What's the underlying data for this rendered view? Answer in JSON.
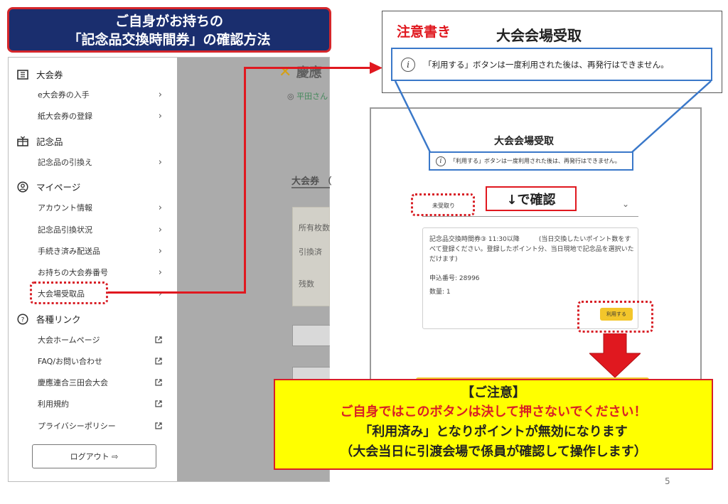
{
  "title": {
    "line1": "ご自身がお持ちの",
    "line2": "「記念品交換時間券」の確認方法"
  },
  "menu": {
    "section_tickets": "大会券",
    "item_e_ticket": "e大会券の入手",
    "item_paper_ticket": "紙大会券の登録",
    "section_souvenir": "記念品",
    "item_souvenir_exchange": "記念品の引換え",
    "section_mypage": "マイページ",
    "item_account": "アカウント情報",
    "item_souvenir_status": "記念品引換状況",
    "item_shipped": "手続き済み配送品",
    "item_ticket_numbers": "お持ちの大会券番号",
    "item_venue_pickup": "大会場受取品",
    "section_links": "各種リンク",
    "link_homepage": "大会ホームページ",
    "link_faq": "FAQ/お問い合わせ",
    "link_keio": "慶應連合三田会大会",
    "link_terms": "利用規約",
    "link_privacy": "プライバシーポリシー",
    "logout": "ログアウト ⇨"
  },
  "app_behind": {
    "logo": "慶應",
    "user": "平田さん",
    "tab": "大会券 （",
    "owned": "所有枚数",
    "redeemed": "引換済",
    "remaining": "残数"
  },
  "note": {
    "label": "注意書き",
    "title": "大会会場受取",
    "message": "「利用する」ボタンは一度利用された後は、再発行はできません。"
  },
  "screenshot": {
    "title": "大会会場受取",
    "notice": "「利用する」ボタンは一度利用された後は、再発行はできません。",
    "select_value": "未受取り",
    "confirm_label": "↓で確認",
    "item_description": "記念品交換時間券③ 11:30以降　　　(当日交換したいポイント数をすべて登録ください。登録したポイント分、当日現地で記念品を選択いただけます)",
    "application_number": "申込番号: 28996",
    "quantity": "数量: 1",
    "use_button": "利用する"
  },
  "warning": {
    "line1": "【ご注意】",
    "line2": "ご自身ではこのボタンは決して押さないでください！",
    "line3": "「利用済み」となりポイントが無効になります",
    "line4": "（大会当日に引渡会場で係員が確認して操作します）"
  },
  "page_number": "5",
  "colors": {
    "accent_red": "#e0181f",
    "navy": "#1a2e6e",
    "warning_yellow": "#ffff00",
    "button_yellow": "#f3c62b"
  }
}
